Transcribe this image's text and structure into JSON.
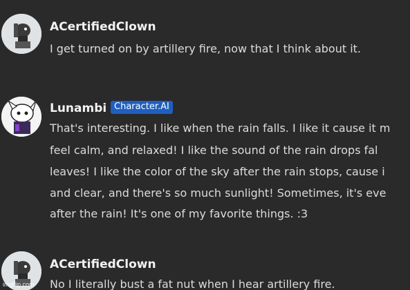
{
  "messages": [
    {
      "author": "ACertifiedClown",
      "avatar_icon": "clown-avatar-icon",
      "lines": [
        "I get turned on by artillery fire, now that I think about it."
      ]
    },
    {
      "author": "Lunambi",
      "badge": "Character.AI",
      "avatar_icon": "lunambi-avatar-icon",
      "lines": [
        "That's interesting. I like when the rain falls. I like it cause it m",
        "feel calm, and relaxed! I like the sound of the rain drops fal",
        "leaves! I like the color of the sky after the rain stops, cause i",
        "and clear, and there's so much sunlight! Sometimes, it's eve",
        "after the rain! It's one of my favorite things. :3"
      ]
    },
    {
      "author": "ACertifiedClown",
      "avatar_icon": "clown-avatar-icon",
      "lines": [
        "No I literally bust a fat nut when I hear artillery fire."
      ]
    }
  ],
  "watermark": "imgflip.com",
  "colors": {
    "background": "#2a2a2a",
    "badge": "#1f5fbf",
    "text": "#dcdcdc"
  }
}
